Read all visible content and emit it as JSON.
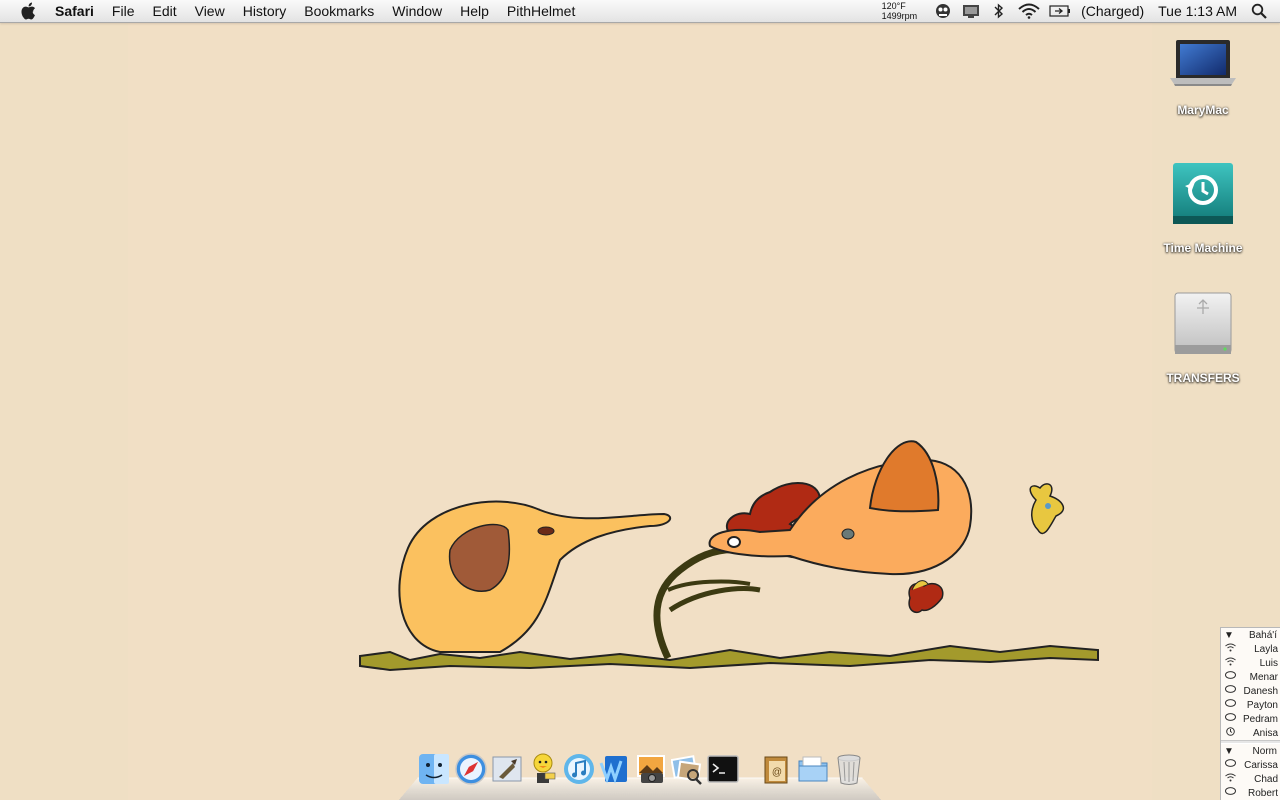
{
  "menubar": {
    "app_name": "Safari",
    "menus": [
      "File",
      "Edit",
      "View",
      "History",
      "Bookmarks",
      "Window",
      "Help",
      "PithHelmet"
    ],
    "status": {
      "temperature": "120°F",
      "fan_speed": "1499rpm",
      "battery_text": "(Charged)",
      "clock": "Tue 1:13 AM"
    }
  },
  "desktop_icons": [
    {
      "label": "MaryMac",
      "icon": "laptop-icon"
    },
    {
      "label": "Time Machine",
      "icon": "time-machine-drive-icon"
    },
    {
      "label": "TRANSFERS",
      "icon": "usb-drive-icon"
    }
  ],
  "dock": {
    "apps": [
      "finder-icon",
      "safari-icon",
      "mail-icon",
      "adium-icon",
      "itunes-icon",
      "word-icon",
      "iphoto-icon",
      "preview-icon",
      "terminal-icon",
      "contacts-folder-icon",
      "documents-folder-icon",
      "trash-icon"
    ]
  },
  "buddy_list": {
    "groups": [
      {
        "name": "Bahá'í",
        "buddies": [
          {
            "name": "Layla",
            "status": "wifi"
          },
          {
            "name": "Luis",
            "status": "wifi"
          },
          {
            "name": "Menar",
            "status": "chat"
          },
          {
            "name": "Danesh",
            "status": "chat"
          },
          {
            "name": "Payton",
            "status": "chat"
          },
          {
            "name": "Pedram",
            "status": "chat"
          },
          {
            "name": "Anisa",
            "status": "idle"
          }
        ]
      },
      {
        "name": "Norm",
        "buddies": [
          {
            "name": "Carissa",
            "status": "chat"
          },
          {
            "name": "Chad",
            "status": "wifi"
          },
          {
            "name": "Robert",
            "status": "chat"
          }
        ]
      }
    ]
  },
  "colors": {
    "wallpaper": "#efdfc4",
    "elephant_body": "#fbc15f",
    "elephant_ear": "#a05a38",
    "pig_body": "#fbab5d",
    "pig_ear": "#e07a2c",
    "flower_red": "#b02a14",
    "grass": "#8a7d1e"
  }
}
